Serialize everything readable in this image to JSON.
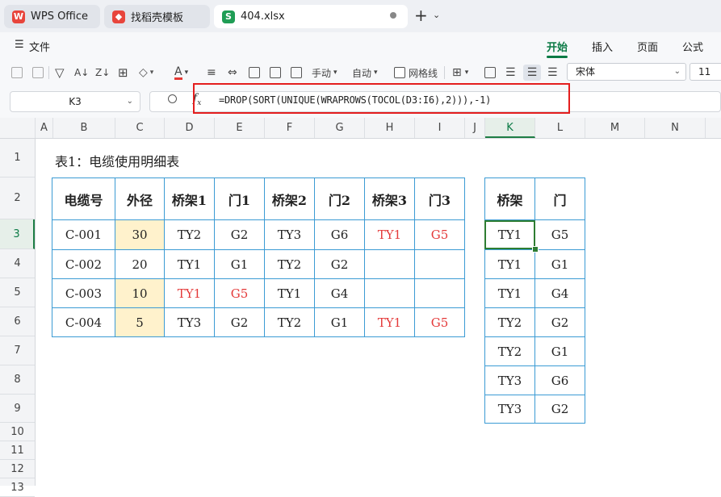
{
  "tabs": [
    {
      "label": "WPS Office",
      "icon": "wps-logo-icon",
      "color": "#e8453c"
    },
    {
      "label": "找稻壳模板",
      "icon": "docer-icon",
      "color": "#e8453c"
    },
    {
      "label": "404.xlsx",
      "icon": "spreadsheet-s-icon",
      "color": "#1f9d55"
    }
  ],
  "menu": {
    "file": "文件",
    "items": [
      "开始",
      "插入",
      "页面",
      "公式"
    ],
    "active": "开始"
  },
  "toolbar": {
    "wrap_manual": "手动",
    "wrap_auto": "自动",
    "gridlines": "网格线",
    "font_name": "宋体",
    "font_size": "11"
  },
  "formula_bar": {
    "cell_ref": "K3",
    "fx": "fx",
    "formula": "=DROP(SORT(UNIQUE(WRAPROWS(TOCOL(D3:I6),2))),-1)"
  },
  "columns": [
    "A",
    "B",
    "C",
    "D",
    "E",
    "F",
    "G",
    "H",
    "I",
    "J",
    "K",
    "L",
    "M",
    "N"
  ],
  "selected_column": "K",
  "rows": [
    "1",
    "2",
    "3",
    "4",
    "5",
    "6",
    "7",
    "8",
    "9",
    "10",
    "11",
    "12",
    "13"
  ],
  "selected_row": "3",
  "sheet_title": "表1：电缆使用明细表",
  "table1": {
    "headers": [
      "电缆号",
      "外径",
      "桥架1",
      "门1",
      "桥架2",
      "门2",
      "桥架3",
      "门3"
    ],
    "rows": [
      [
        "C-001",
        "30",
        "TY2",
        "G2",
        "TY3",
        "G6",
        "TY1",
        "G5"
      ],
      [
        "C-002",
        "20",
        "TY1",
        "G1",
        "TY2",
        "G2",
        "",
        ""
      ],
      [
        "C-003",
        "10",
        "TY1",
        "G5",
        "TY1",
        "G4",
        "",
        ""
      ],
      [
        "C-004",
        "5",
        "TY3",
        "G2",
        "TY2",
        "G1",
        "TY1",
        "G5"
      ]
    ],
    "highlight_color": "#fff2cc",
    "red_text_color": "#e43a3a"
  },
  "table2": {
    "headers": [
      "桥架",
      "门"
    ],
    "rows": [
      [
        "TY1",
        "G5"
      ],
      [
        "TY1",
        "G1"
      ],
      [
        "TY1",
        "G4"
      ],
      [
        "TY2",
        "G2"
      ],
      [
        "TY2",
        "G1"
      ],
      [
        "TY3",
        "G6"
      ],
      [
        "TY3",
        "G2"
      ]
    ]
  },
  "colors": {
    "accent_green": "#0b7a45",
    "annotation_red": "#e41e1e",
    "table_border": "#3b9bd4"
  }
}
